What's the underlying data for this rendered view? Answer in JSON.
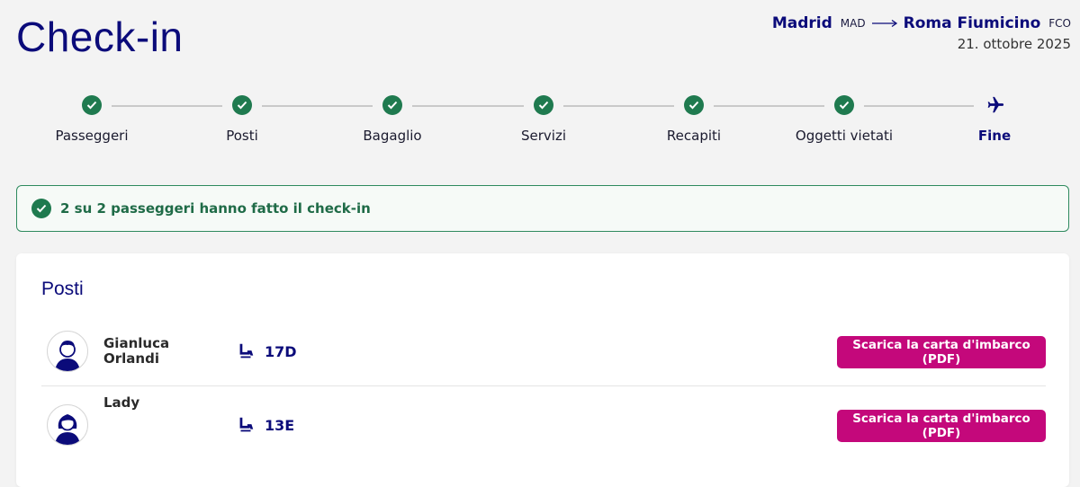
{
  "header": {
    "title": "Check-in",
    "origin_city": "Madrid",
    "origin_code": "MAD",
    "destination_city": "Roma Fiumicino",
    "destination_code": "FCO",
    "date": "21. ottobre 2025"
  },
  "steps": [
    {
      "label": "Passeggeri",
      "status": "done"
    },
    {
      "label": "Posti",
      "status": "done"
    },
    {
      "label": "Bagaglio",
      "status": "done"
    },
    {
      "label": "Servizi",
      "status": "done"
    },
    {
      "label": "Recapiti",
      "status": "done"
    },
    {
      "label": "Oggetti vietati",
      "status": "done"
    },
    {
      "label": "Fine",
      "status": "current"
    }
  ],
  "banner": {
    "text": "2 su 2 passeggeri hanno fatto il check-in"
  },
  "seats_card": {
    "title": "Posti",
    "passengers": [
      {
        "name": "Gianluca Orlandi",
        "seat": "17D",
        "button": "Scarica la carta d'imbarco (PDF)",
        "avatar": "male-avatar-icon"
      },
      {
        "name": "Lady",
        "seat": "13E",
        "button": "Scarica la carta d'imbarco (PDF)",
        "avatar": "female-avatar-icon"
      }
    ]
  },
  "colors": {
    "brand": "#0b0b7a",
    "success": "#1f7a4f",
    "accent": "#c4087b"
  }
}
